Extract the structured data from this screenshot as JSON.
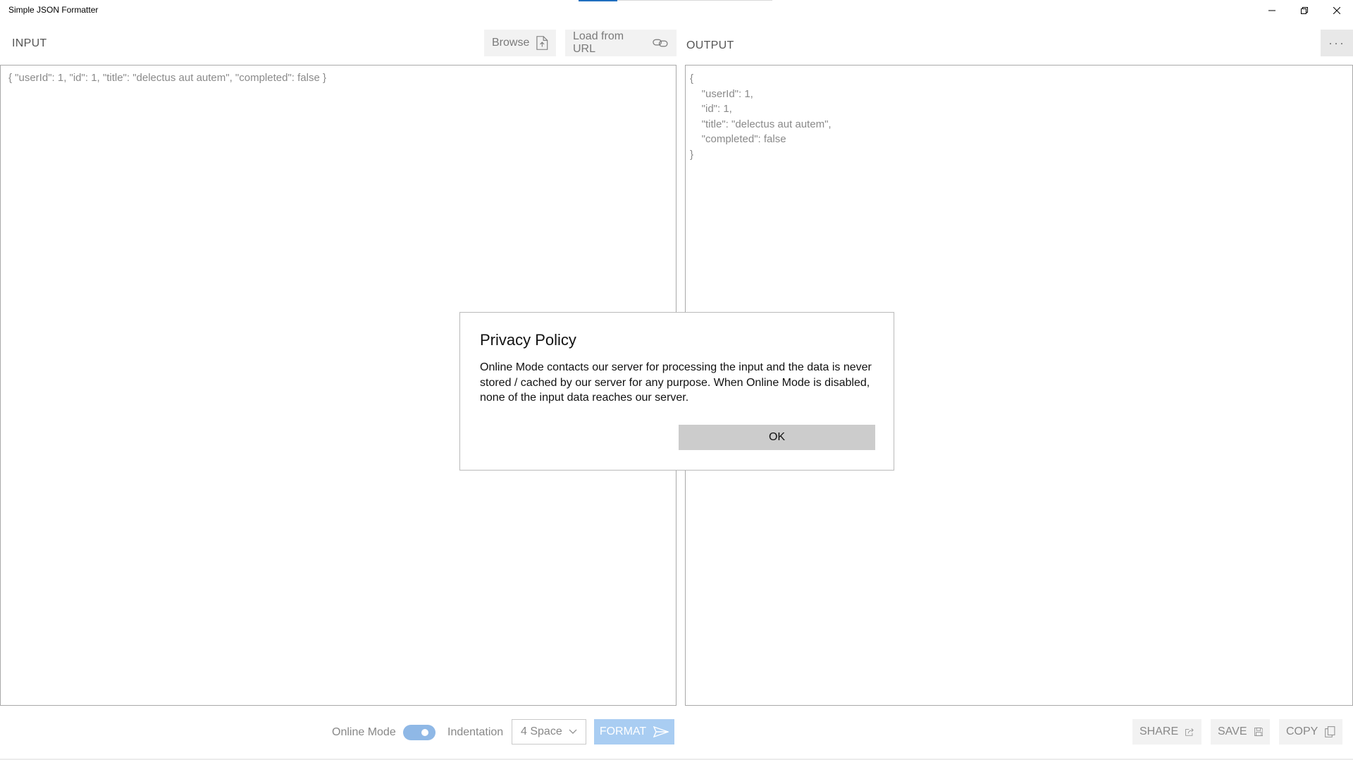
{
  "window": {
    "title": "Simple JSON Formatter",
    "minimize_icon": "minimize-icon",
    "restore_icon": "restore-icon",
    "close_icon": "close-icon"
  },
  "input": {
    "title": "INPUT",
    "browse_label": "Browse",
    "load_url_label": "Load from URL",
    "text": "{ \"userId\": 1, \"id\": 1, \"title\": \"delectus aut autem\", \"completed\": false }"
  },
  "output": {
    "title": "OUTPUT",
    "more_label": "···",
    "text": "{\n    \"userId\": 1,\n    \"id\": 1,\n    \"title\": \"delectus aut autem\",\n    \"completed\": false\n}"
  },
  "bottom": {
    "online_mode_label": "Online Mode",
    "online_mode_on": true,
    "indentation_label": "Indentation",
    "indentation_value": "4 Space",
    "format_label": "FORMAT",
    "share_label": "SHARE",
    "save_label": "SAVE",
    "copy_label": "COPY"
  },
  "dialog": {
    "title": "Privacy Policy",
    "body": "Online Mode contacts our server for processing the input and the data is never stored / cached by our server for any purpose. When Online Mode is disabled, none of the input data reaches our server.",
    "ok_label": "OK"
  },
  "colors": {
    "accent": "#1f6fbf",
    "format_button": "#a9cdf2",
    "toggle_on": "#8fb8e6"
  }
}
